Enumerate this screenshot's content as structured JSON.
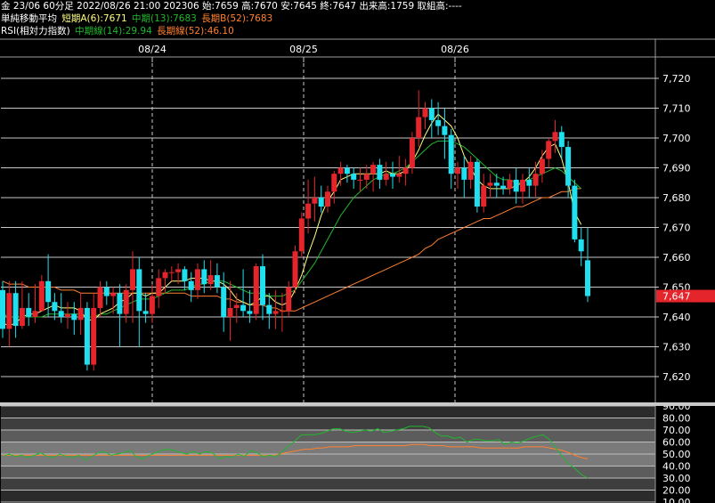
{
  "header": {
    "line1": "金 23/06 60分足 2022/08/26 21:00 202306 始:7659 高:7670 安:7645 終:7647 出来高:1759 取組高:----",
    "ma_title": "単純移動平均",
    "ma_short": "短期A(6):7671",
    "ma_mid": "中期(13):7683",
    "ma_long": "長期B(52):7683",
    "rsi_title": "RSI(相対力指数)",
    "rsi_mid": "中期線(14):29.94",
    "rsi_long": "長期線(52):46.10"
  },
  "colors": {
    "background": "#000000",
    "up_candle": "#e4262c",
    "down_candle": "#20e0f0",
    "ma_short": "#ffff80",
    "ma_mid": "#1fb82c",
    "ma_long": "#ff8030",
    "rsi_mid": "#1fb82c",
    "rsi_long": "#ff8030",
    "price_tag": "#e4262c"
  },
  "chart_data": [
    {
      "type": "candlestick",
      "x_labels": [
        "08/24",
        "08/25",
        "08/26"
      ],
      "ylim": [
        7616,
        7728
      ],
      "y_ticks": [
        "7,720",
        "7,710",
        "7,700",
        "7,690",
        "7,680",
        "7,670",
        "7,660",
        "7,650",
        "7,640",
        "7,630",
        "7,620"
      ],
      "last_price_label": "7,647",
      "candles": [
        [
          7649,
          7652,
          7633,
          7636
        ],
        [
          7636,
          7652,
          7630,
          7648
        ],
        [
          7648,
          7652,
          7633,
          7637
        ],
        [
          7637,
          7652,
          7636,
          7643
        ],
        [
          7643,
          7648,
          7637,
          7640
        ],
        [
          7640,
          7651,
          7638,
          7642
        ],
        [
          7642,
          7654,
          7642,
          7652
        ],
        [
          7652,
          7661,
          7640,
          7645
        ],
        [
          7645,
          7648,
          7639,
          7642
        ],
        [
          7642,
          7648,
          7638,
          7640
        ],
        [
          7640,
          7645,
          7636,
          7641
        ],
        [
          7641,
          7645,
          7634,
          7639
        ],
        [
          7639,
          7648,
          7634,
          7643
        ],
        [
          7643,
          7645,
          7622,
          7624
        ],
        [
          7624,
          7648,
          7622,
          7643
        ],
        [
          7643,
          7652,
          7640,
          7650
        ],
        [
          7650,
          7652,
          7644,
          7647
        ],
        [
          7647,
          7650,
          7641,
          7648
        ],
        [
          7648,
          7651,
          7630,
          7641
        ],
        [
          7641,
          7651,
          7638,
          7649
        ],
        [
          7649,
          7662,
          7638,
          7656
        ],
        [
          7656,
          7660,
          7630,
          7642
        ],
        [
          7642,
          7648,
          7638,
          7641
        ],
        [
          7641,
          7651,
          7638,
          7647
        ],
        [
          7647,
          7656,
          7643,
          7653
        ],
        [
          7653,
          7656,
          7648,
          7655
        ],
        [
          7655,
          7657,
          7652,
          7655
        ],
        [
          7655,
          7658,
          7651,
          7656
        ],
        [
          7656,
          7657,
          7649,
          7652
        ],
        [
          7652,
          7655,
          7645,
          7649
        ],
        [
          7649,
          7658,
          7646,
          7656
        ],
        [
          7656,
          7659,
          7648,
          7651
        ],
        [
          7651,
          7659,
          7649,
          7654
        ],
        [
          7654,
          7658,
          7648,
          7650
        ],
        [
          7650,
          7655,
          7635,
          7640
        ],
        [
          7640,
          7652,
          7632,
          7643
        ],
        [
          7643,
          7648,
          7638,
          7644
        ],
        [
          7644,
          7656,
          7640,
          7642
        ],
        [
          7642,
          7649,
          7638,
          7641
        ],
        [
          7641,
          7658,
          7639,
          7657
        ],
        [
          7657,
          7661,
          7639,
          7644
        ],
        [
          7644,
          7648,
          7636,
          7641
        ],
        [
          7641,
          7649,
          7636,
          7642
        ],
        [
          7642,
          7648,
          7635,
          7642
        ],
        [
          7642,
          7652,
          7640,
          7650
        ],
        [
          7650,
          7664,
          7648,
          7662
        ],
        [
          7662,
          7675,
          7660,
          7673
        ],
        [
          7673,
          7686,
          7668,
          7678
        ],
        [
          7678,
          7687,
          7672,
          7680
        ],
        [
          7680,
          7684,
          7675,
          7677
        ],
        [
          7677,
          7684,
          7675,
          7682
        ],
        [
          7682,
          7689,
          7678,
          7688
        ],
        [
          7688,
          7692,
          7684,
          7690
        ],
        [
          7690,
          7691,
          7685,
          7688
        ],
        [
          7688,
          7690,
          7683,
          7686
        ],
        [
          7686,
          7690,
          7682,
          7686
        ],
        [
          7686,
          7691,
          7683,
          7688
        ],
        [
          7688,
          7692,
          7682,
          7691
        ],
        [
          7691,
          7693,
          7683,
          7686
        ],
        [
          7686,
          7692,
          7684,
          7688
        ],
        [
          7688,
          7692,
          7683,
          7687
        ],
        [
          7687,
          7694,
          7685,
          7688
        ],
        [
          7688,
          7693,
          7684,
          7690
        ],
        [
          7690,
          7702,
          7688,
          7700
        ],
        [
          7700,
          7716,
          7697,
          7707
        ],
        [
          7707,
          7712,
          7703,
          7710
        ],
        [
          7710,
          7713,
          7700,
          7706
        ],
        [
          7706,
          7712,
          7701,
          7704
        ],
        [
          7704,
          7710,
          7693,
          7701
        ],
        [
          7701,
          7703,
          7683,
          7688
        ],
        [
          7688,
          7692,
          7683,
          7690
        ],
        [
          7690,
          7694,
          7680,
          7686
        ],
        [
          7686,
          7694,
          7683,
          7692
        ],
        [
          7692,
          7693,
          7675,
          7677
        ],
        [
          7677,
          7688,
          7675,
          7684
        ],
        [
          7684,
          7688,
          7680,
          7685
        ],
        [
          7685,
          7688,
          7680,
          7684
        ],
        [
          7684,
          7687,
          7681,
          7683
        ],
        [
          7683,
          7688,
          7681,
          7686
        ],
        [
          7686,
          7690,
          7678,
          7682
        ],
        [
          7682,
          7688,
          7678,
          7686
        ],
        [
          7686,
          7690,
          7680,
          7684
        ],
        [
          7684,
          7692,
          7680,
          7688
        ],
        [
          7688,
          7696,
          7685,
          7693
        ],
        [
          7693,
          7700,
          7690,
          7699
        ],
        [
          7699,
          7706,
          7695,
          7702
        ],
        [
          7702,
          7704,
          7693,
          7697
        ],
        [
          7697,
          7699,
          7680,
          7684
        ],
        [
          7684,
          7686,
          7665,
          7666
        ],
        [
          7666,
          7670,
          7657,
          7662
        ],
        [
          7659,
          7670,
          7645,
          7647
        ]
      ],
      "ma_short": [
        7638,
        7637,
        7638,
        7640,
        7641,
        7641,
        7642,
        7643,
        7644,
        7643,
        7643,
        7643,
        7642,
        7639,
        7639,
        7641,
        7642,
        7643,
        7645,
        7646,
        7648,
        7648,
        7647,
        7648,
        7648,
        7650,
        7652,
        7652,
        7652,
        7653,
        7653,
        7653,
        7652,
        7652,
        7651,
        7649,
        7646,
        7645,
        7644,
        7645,
        7647,
        7647,
        7645,
        7644,
        7645,
        7649,
        7654,
        7661,
        7667,
        7674,
        7679,
        7682,
        7686,
        7687,
        7688,
        7688,
        7688,
        7688,
        7688,
        7689,
        7688,
        7688,
        7689,
        7692,
        7696,
        7701,
        7705,
        7708,
        7706,
        7704,
        7700,
        7694,
        7690,
        7686,
        7684,
        7683,
        7683,
        7683,
        7683,
        7684,
        7685,
        7687,
        7690,
        7694,
        7697,
        7698,
        7693,
        7685,
        7675,
        7671
      ],
      "ma_mid": [
        7641,
        7640,
        7640,
        7640,
        7640,
        7640,
        7640,
        7641,
        7641,
        7641,
        7641,
        7641,
        7641,
        7640,
        7640,
        7641,
        7641,
        7642,
        7643,
        7644,
        7645,
        7646,
        7646,
        7646,
        7647,
        7648,
        7649,
        7649,
        7649,
        7650,
        7651,
        7651,
        7652,
        7652,
        7652,
        7651,
        7650,
        7649,
        7648,
        7648,
        7648,
        7647,
        7647,
        7647,
        7648,
        7649,
        7652,
        7655,
        7658,
        7662,
        7666,
        7670,
        7674,
        7677,
        7680,
        7682,
        7684,
        7686,
        7687,
        7688,
        7688,
        7689,
        7690,
        7692,
        7694,
        7696,
        7698,
        7699,
        7699,
        7699,
        7698,
        7697,
        7695,
        7693,
        7691,
        7689,
        7687,
        7686,
        7686,
        7685,
        7685,
        7686,
        7687,
        7688,
        7689,
        7690,
        7689,
        7687,
        7685,
        7683
      ],
      "ma_long": [
        7652,
        7651,
        7651,
        7651,
        7650,
        7650,
        7650,
        7650,
        7650,
        7649,
        7649,
        7649,
        7648,
        7648,
        7648,
        7648,
        7648,
        7648,
        7648,
        7648,
        7648,
        7648,
        7648,
        7648,
        7648,
        7648,
        7648,
        7648,
        7648,
        7647,
        7647,
        7647,
        7647,
        7647,
        7646,
        7646,
        7645,
        7645,
        7644,
        7644,
        7644,
        7643,
        7643,
        7642,
        7642,
        7642,
        7643,
        7644,
        7645,
        7646,
        7647,
        7648,
        7649,
        7650,
        7651,
        7652,
        7653,
        7654,
        7655,
        7656,
        7657,
        7658,
        7659,
        7660,
        7661,
        7663,
        7664,
        7666,
        7667,
        7668,
        7669,
        7670,
        7671,
        7672,
        7673,
        7673,
        7674,
        7675,
        7676,
        7677,
        7677,
        7678,
        7679,
        7680,
        7680,
        7681,
        7682,
        7682,
        7683,
        7683
      ]
    },
    {
      "type": "line",
      "title": "RSI(相対力指数)",
      "ylim": [
        10,
        90
      ],
      "y_ticks": [
        "90.00",
        "80.00",
        "70.00",
        "60.00",
        "50.00",
        "40.00",
        "30.00",
        "20.00",
        "10.00"
      ],
      "series": [
        {
          "name": "中期線(14)",
          "values": [
            48,
            50,
            48,
            49,
            47,
            49,
            51,
            48,
            47,
            50,
            48,
            47,
            49,
            45,
            48,
            51,
            52,
            49,
            50,
            51,
            53,
            48,
            46,
            49,
            51,
            53,
            54,
            53,
            51,
            50,
            52,
            50,
            52,
            51,
            46,
            48,
            47,
            50,
            48,
            53,
            51,
            48,
            49,
            48,
            52,
            57,
            61,
            66,
            66,
            66,
            67,
            69,
            71,
            71,
            69,
            68,
            69,
            70,
            69,
            71,
            68,
            69,
            70,
            71,
            73,
            73,
            73,
            72,
            68,
            65,
            65,
            63,
            64,
            60,
            62,
            62,
            61,
            61,
            62,
            58,
            60,
            59,
            61,
            63,
            65,
            66,
            62,
            55,
            48,
            42,
            38,
            33,
            30
          ]
        },
        {
          "name": "長期線(52)",
          "values": [
            49,
            49,
            49,
            49,
            49,
            49,
            49,
            49,
            49,
            49,
            49,
            49,
            49,
            49,
            49,
            49,
            49,
            49,
            49,
            49,
            49,
            49,
            49,
            49,
            49,
            49,
            49,
            49,
            49,
            49,
            49,
            49,
            49,
            49,
            49,
            49,
            49,
            49,
            49,
            49,
            49,
            49,
            49,
            49,
            50,
            51,
            52,
            53,
            54,
            54,
            55,
            55,
            56,
            56,
            56,
            56,
            57,
            57,
            57,
            57,
            57,
            57,
            57,
            57,
            57,
            58,
            58,
            58,
            57,
            57,
            57,
            56,
            56,
            56,
            56,
            56,
            55,
            55,
            55,
            55,
            55,
            55,
            55,
            56,
            56,
            56,
            56,
            55,
            54,
            53,
            51,
            49,
            47,
            46
          ]
        }
      ]
    }
  ]
}
